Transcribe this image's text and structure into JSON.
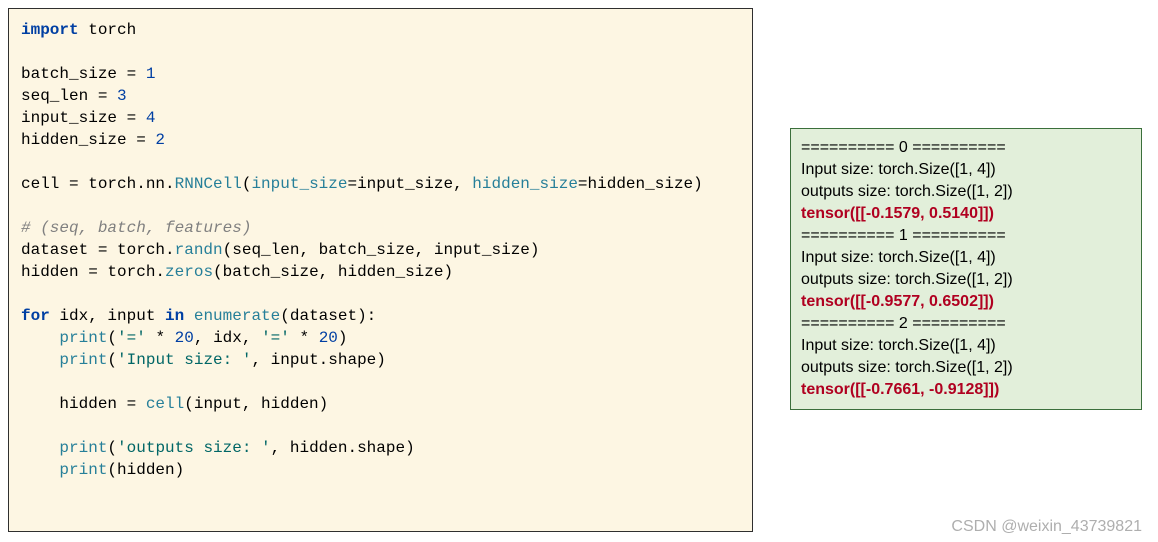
{
  "code": {
    "l1_kw": "import",
    "l1_mod": " torch",
    "l3a": "batch_size = ",
    "l3n": "1",
    "l4a": "seq_len = ",
    "l4n": "3",
    "l5a": "input_size = ",
    "l5n": "4",
    "l6a": "hidden_size = ",
    "l6n": "2",
    "l8a": "cell = torch.nn.",
    "l8fn": "RNNCell",
    "l8b": "(",
    "l8p1": "input_size",
    "l8c": "=input_size, ",
    "l8p2": "hidden_size",
    "l8d": "=hidden_size)",
    "l10": "# (seq, batch, features)",
    "l11a": "dataset = torch.",
    "l11fn": "randn",
    "l11b": "(seq_len, batch_size, input_size)",
    "l12a": "hidden = torch.",
    "l12fn": "zeros",
    "l12b": "(batch_size, hidden_size)",
    "l14_for": "for",
    "l14a": " idx, input ",
    "l14_in": "in",
    "l14b": " ",
    "l14fn": "enumerate",
    "l14c": "(dataset):",
    "l15a": "    ",
    "l15fn": "print",
    "l15b": "(",
    "l15s1": "'='",
    "l15c": " * ",
    "l15n1": "20",
    "l15d": ", idx, ",
    "l15s2": "'='",
    "l15e": " * ",
    "l15n2": "20",
    "l15f": ")",
    "l16a": "    ",
    "l16fn": "print",
    "l16b": "(",
    "l16s": "'Input size: '",
    "l16c": ", input.shape)",
    "l18a": "    hidden = ",
    "l18fn": "cell",
    "l18b": "(input, hidden)",
    "l20a": "    ",
    "l20fn": "print",
    "l20b": "(",
    "l20s": "'outputs size: '",
    "l20c": ", hidden.shape)",
    "l21a": "    ",
    "l21fn": "print",
    "l21b": "(hidden)"
  },
  "out": {
    "sep0": "========== 0 ==========",
    "in0": "Input size:  torch.Size([1, 4])",
    "out0": "outputs size:  torch.Size([1, 2])",
    "t0": "tensor([[-0.1579,  0.5140]])",
    "sep1": "========== 1 ==========",
    "in1": "Input size:  torch.Size([1, 4])",
    "out1": "outputs size:  torch.Size([1, 2])",
    "t1": "tensor([[-0.9577,  0.6502]])",
    "sep2": "========== 2 ==========",
    "in2": "Input size:  torch.Size([1, 4])",
    "out2": "outputs size:  torch.Size([1, 2])",
    "t2": "tensor([[-0.7661, -0.9128]])"
  },
  "watermark": "CSDN @weixin_43739821"
}
